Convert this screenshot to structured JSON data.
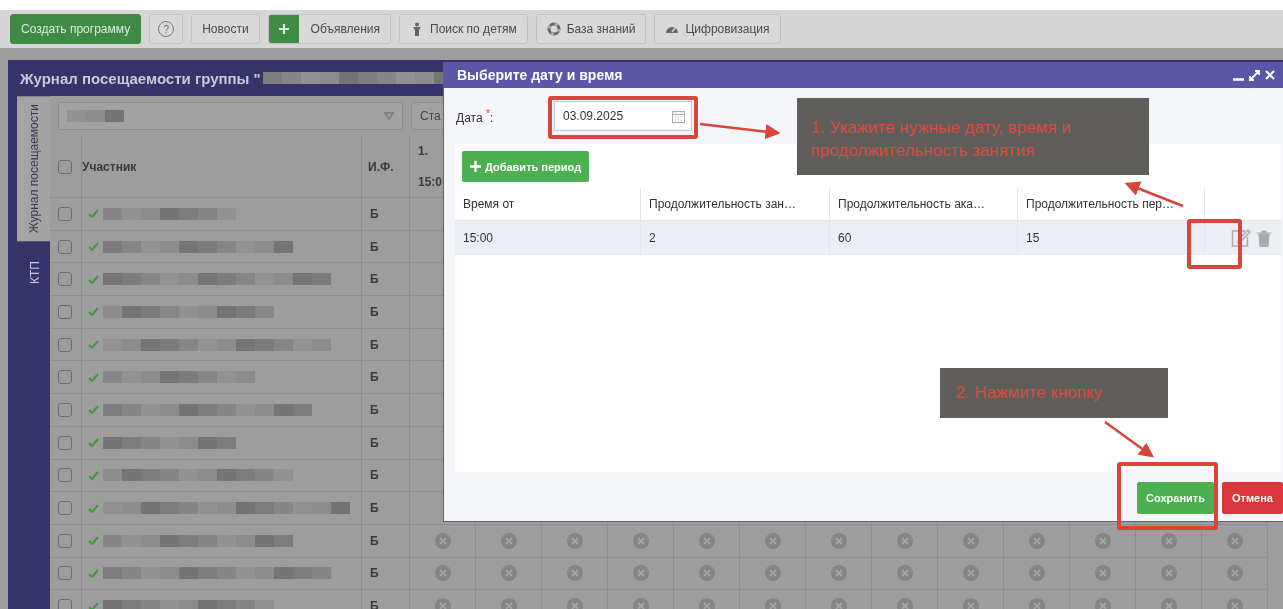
{
  "toolbar": {
    "buttons": [
      {
        "kind": "primary",
        "label": "Создать программу"
      },
      {
        "kind": "help",
        "label": "?"
      },
      {
        "kind": "plain",
        "label": "Новости"
      },
      {
        "kind": "add",
        "label": "Объявления"
      },
      {
        "kind": "person",
        "label": "Поиск по детям"
      },
      {
        "kind": "lifebuoy",
        "label": "База знаний"
      },
      {
        "kind": "gauge",
        "label": "Цифровизация"
      }
    ]
  },
  "journal": {
    "title": "Журнал посещаемости группы \"",
    "side_tabs": [
      {
        "label": "Журнал посещаемости",
        "selected": true
      },
      {
        "label": "КТП",
        "selected": false
      }
    ],
    "filter_button": "Ста",
    "header_checked": false,
    "columns": [
      "Участник",
      "И.Ф."
    ],
    "date_column": {
      "day": "1.",
      "time": "15:0"
    },
    "rows": [
      {
        "checked": false,
        "confirmed": true,
        "initials": "Б"
      },
      {
        "checked": false,
        "confirmed": true,
        "initials": "Б"
      },
      {
        "checked": false,
        "confirmed": true,
        "initials": "Б"
      },
      {
        "checked": false,
        "confirmed": true,
        "initials": "Б"
      },
      {
        "checked": false,
        "confirmed": true,
        "initials": "Б"
      },
      {
        "checked": false,
        "confirmed": true,
        "initials": "Б"
      },
      {
        "checked": false,
        "confirmed": true,
        "initials": "Б"
      },
      {
        "checked": false,
        "confirmed": true,
        "initials": "Б"
      },
      {
        "checked": false,
        "confirmed": true,
        "initials": "Б"
      },
      {
        "checked": false,
        "confirmed": true,
        "initials": "Б"
      },
      {
        "checked": false,
        "confirmed": true,
        "initials": "Б",
        "absent": true
      },
      {
        "checked": false,
        "confirmed": true,
        "initials": "Б",
        "absent": true
      },
      {
        "checked": false,
        "confirmed": true,
        "initials": "Б",
        "absent": true
      }
    ]
  },
  "dialog": {
    "title": "Выберите дату и время",
    "date": {
      "label": "Дата $^{*}$:",
      "value": "03.09.2025"
    },
    "add_button": "Добавить период",
    "table": {
      "columns": [
        "Время от",
        "Продолжительность зан…",
        "Продолжительность ака…",
        "Продолжительность пер…"
      ],
      "rows": [
        {
          "cells": [
            "15:00",
            "2",
            "60",
            "15"
          ],
          "selected": true
        }
      ]
    },
    "buttons": [
      {
        "kind": "save",
        "label": "Сохранить"
      },
      {
        "kind": "cancel",
        "label": "Отмена"
      }
    ]
  },
  "annotations": [
    {
      "text": "1. Укажите нужные дату, время и продолжительность занятия"
    },
    {
      "text": "2. Нажмите кнопку"
    }
  ]
}
